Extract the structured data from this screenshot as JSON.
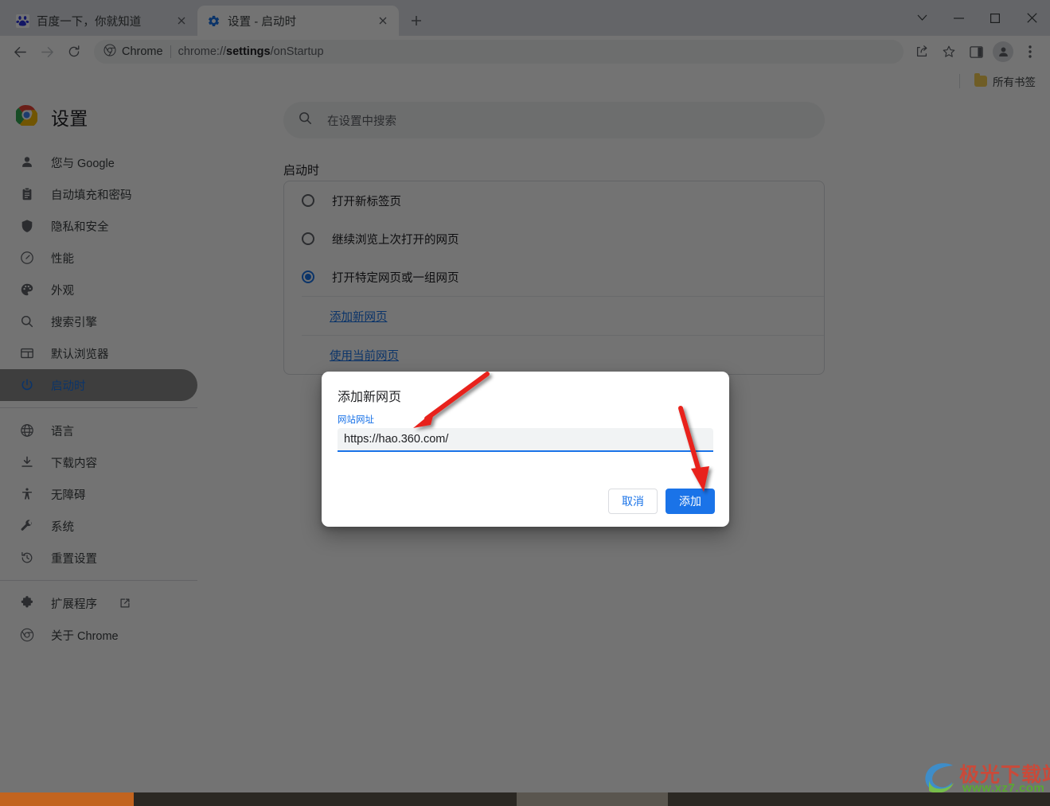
{
  "window": {
    "controls": [
      {
        "name": "tab-search",
        "glyph": "⌄"
      },
      {
        "name": "minimize",
        "glyph": "—"
      },
      {
        "name": "maximize",
        "glyph": "▢"
      },
      {
        "name": "close",
        "glyph": "✕"
      }
    ]
  },
  "tabs": [
    {
      "title": "百度一下，你就知道",
      "favicon": "baidu-icon",
      "active": false
    },
    {
      "title": "设置 - 启动时",
      "favicon": "settings-gear-icon",
      "active": true
    }
  ],
  "newtab_tooltip": "新建标签页",
  "toolbar": {
    "back": "后退",
    "forward": "前进",
    "reload": "重新加载",
    "chip_label": "Chrome",
    "url_prefix": "chrome://",
    "url_bold": "settings",
    "url_suffix": "/onStartup",
    "share": "分享",
    "bookmark": "将此标签页加入书签",
    "sidepanel": "显示side panel",
    "profile": "个人资料",
    "menu": "自定义及控制 Google Chrome"
  },
  "bookmarks_bar": {
    "all_bookmarks": "所有书签"
  },
  "settings": {
    "title": "设置",
    "search_placeholder": "在设置中搜索",
    "sidebar": [
      {
        "label": "您与 Google",
        "icon": "person-icon",
        "active": false
      },
      {
        "label": "自动填充和密码",
        "icon": "clipboard-icon",
        "active": false
      },
      {
        "label": "隐私和安全",
        "icon": "shield-icon",
        "active": false
      },
      {
        "label": "性能",
        "icon": "speedometer-icon",
        "active": false
      },
      {
        "label": "外观",
        "icon": "palette-icon",
        "active": false
      },
      {
        "label": "搜索引擎",
        "icon": "search-icon",
        "active": false
      },
      {
        "label": "默认浏览器",
        "icon": "browser-window-icon",
        "active": false
      },
      {
        "label": "启动时",
        "icon": "power-icon",
        "active": true
      },
      {
        "label": "语言",
        "icon": "globe-icon",
        "active": false
      },
      {
        "label": "下载内容",
        "icon": "download-icon",
        "active": false
      },
      {
        "label": "无障碍",
        "icon": "accessibility-icon",
        "active": false
      },
      {
        "label": "系统",
        "icon": "wrench-icon",
        "active": false
      },
      {
        "label": "重置设置",
        "icon": "history-restore-icon",
        "active": false
      },
      {
        "label": "扩展程序",
        "icon": "puzzle-icon",
        "active": false,
        "external": true
      },
      {
        "label": "关于 Chrome",
        "icon": "chrome-logo-icon",
        "active": false
      }
    ],
    "section_title": "启动时",
    "startup_options": [
      {
        "label": "打开新标签页",
        "checked": false
      },
      {
        "label": "继续浏览上次打开的网页",
        "checked": false
      },
      {
        "label": "打开特定网页或一组网页",
        "checked": true
      }
    ],
    "links": [
      {
        "label": "添加新网页"
      },
      {
        "label": "使用当前网页"
      }
    ]
  },
  "dialog": {
    "title": "添加新网页",
    "field_label": "网站网址",
    "url_value": "https://hao.360.com/",
    "url_placeholder": "",
    "cancel_label": "取消",
    "add_label": "添加"
  },
  "watermark": {
    "text": "极光下载站",
    "subtext": "www.xz7.com"
  },
  "colors": {
    "accent_blue": "#1a73e8",
    "annotation_red": "#e8231b",
    "tabstrip_bg": "#dee1e6",
    "active_nav_text": "#1a73e8"
  }
}
